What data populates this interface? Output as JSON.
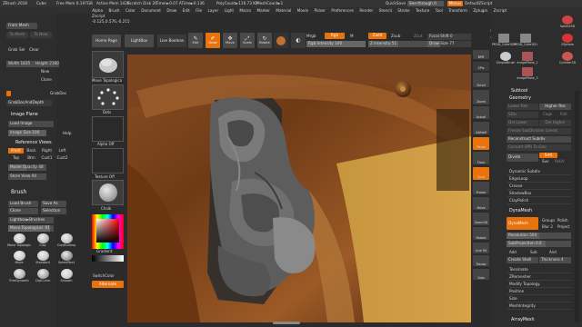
{
  "menubar": {
    "app": "ZBrush 2018",
    "doc": "Cube",
    "free_mem": "Free Mem 6.197GB",
    "active_mem": "Active Mem 1428",
    "scratch": "Scratch Disk 20",
    "timer": "Timer►0.07 ATime►0.136",
    "polycount": "PolyCount►116.73 KP",
    "meshcount": "MeshCount►1",
    "quicksave": "QuickSave",
    "seethrough": "See-through",
    "seethrough_val": "0",
    "menus_btn": "Menus",
    "default_script": "DefaultZScript",
    "items": [
      "Alpha",
      "Brush",
      "Color",
      "Document",
      "Draw",
      "Edit",
      "File",
      "Layer",
      "Light",
      "Macro",
      "Marker",
      "Material",
      "Movie",
      "Picker",
      "Preferences",
      "Render",
      "Stencil",
      "Stroke",
      "Texture",
      "Tool",
      "Transform",
      "Zplugin",
      "Zscript"
    ]
  },
  "status": {
    "zscript": "Zscript",
    "coords": "-0.125,0.576,-0.215"
  },
  "top_toolbar": {
    "home": "Home Page",
    "lightbox": "LightBox",
    "live_boolean": "Live Boolean",
    "edit": "Edit",
    "draw": "Draw",
    "move": "Move",
    "scale": "Scale",
    "rotate": "Rotate",
    "mrgb": "Mrgb",
    "rgb": "Rgb",
    "m": "M",
    "zadd": "Zadd",
    "zsub": "Zsub",
    "zcut": "Zcut",
    "rgb_intensity": "Rgb Intensity",
    "rgb_intensity_val": "100",
    "z_intensity": "Z Intensity",
    "z_intensity_val": "51",
    "focal_shift": "Focal Shift",
    "focal_shift_val": "0",
    "draw_size": "Draw Size",
    "draw_size_val": "77",
    "dynamic": "Dynamic",
    "active_points": "ActivePoints: 116,738",
    "total_points": "TotalPoints: 116,738"
  },
  "left_panel": {
    "from_mesh": "From Mesh",
    "to_mesh": "To Mesh",
    "to_new": "To New",
    "grab": "Grab",
    "sel": "Sel",
    "clear": "Clear",
    "width_label": "Width",
    "width": "1835",
    "height_label": "Height",
    "height": "2160",
    "new": "New",
    "clone": "Clone",
    "grabdoc": "GrabDoc",
    "grabdoc_and_depth": "GrabDocAndDepth",
    "image_plane": "Image Plane",
    "load_image": "Load Image",
    "image_size_label": "Image Size",
    "image_size": "100",
    "help": "Help",
    "reference_views": "Reference Views",
    "views": [
      "Front",
      "Back",
      "Right",
      "Left",
      "Top",
      "Btm",
      "Cust1",
      "Cust2"
    ],
    "model_opacity_label": "Model Opacity",
    "model_opacity": "48",
    "store_view": "Store View",
    "store_view_val": "All",
    "brush_title": "Brush",
    "load_brush": "Load Brush",
    "save_as": "Save As",
    "clone_b": "Clone",
    "selection": "Selection",
    "lightbox_brushes": "Lightbox►Brushes",
    "move_topological": "Move Topological",
    "move_topological_val": "91",
    "brushes": [
      "Move Topologic",
      "Clay",
      "ClayBuildup",
      "Move",
      "Standard",
      "SelectRect",
      "TrimDynamic",
      "ClipCurve",
      "Smooth"
    ]
  },
  "left_tools": {
    "brush_name": "Move Topologica",
    "stroke_name": "Dots",
    "alpha_name": "Alpha Off",
    "texture_name": "Texture Off",
    "material_name": "Chalk",
    "gradient": "Gradient",
    "switch_color": "SwitchColor",
    "alternate": "Alternate"
  },
  "right_shelf": {
    "bpr": "BPR",
    "spix": "SPix",
    "spix_val": "3",
    "scroll": "Scroll",
    "zoom": "Zoom",
    "actual": "Actual",
    "aahalf": "AAHalf",
    "persp": "Persp",
    "floor": "Floor",
    "local": "Local",
    "xyz": "Qxyz",
    "frame": "Frame",
    "move": "Move",
    "zoom3d": "Zoom3D",
    "rotate": "Rotate",
    "line_fill": "Line Fill",
    "polyf": "PolyF",
    "transp": "Transp",
    "ghost": "Ghost",
    "solo": "Solo",
    "xpose": "Xpose"
  },
  "right_panel": {
    "tools": [
      {
        "name": "PM3D_Cube3D1",
        "val": "2"
      },
      {
        "name": "PM3D_Cube3D1",
        "val": ""
      },
      {
        "name": "SimpleBrush",
        "val": ""
      },
      {
        "name": "ImagePlane_1",
        "val": ""
      },
      {
        "name": "ImagePlane_3",
        "val": ""
      }
    ],
    "top_tools": [
      {
        "name": "Sphere3D",
        "val": ""
      },
      {
        "name": "ZSphere",
        "val": ""
      },
      {
        "name": "Cylinder3D",
        "val": ""
      }
    ],
    "subtool": "Subtool",
    "geometry": "Geometry",
    "lower_res": "Lower Res",
    "higher_res": "Higher Res",
    "sdiv": "SDiv",
    "cage": "Cage",
    "rstr": "Rstr",
    "del_lower": "Del Lower",
    "del_higher": "Del Higher",
    "freeze_subdiv": "Freeze SubDivision Levels",
    "reconstruct_subdiv": "Reconstruct Subdiv",
    "convert_bpr": "Convert BPR To Geo",
    "divide": "Divide",
    "smt": "Smt",
    "suv": "Suv",
    "reuv": "ReUV",
    "dynamic_subdiv": "Dynamic Subdiv",
    "edgeloop": "EdgeLoop",
    "crease": "Crease",
    "shadowbox": "ShadowBox",
    "claypolish": "ClayPolish",
    "dynamesh_header": "DynaMesh",
    "dynamesh": "DynaMesh",
    "groups": "Groups",
    "polish": "Polish",
    "blur": "Blur",
    "blur_val": "2",
    "project": "Project",
    "resolution_label": "Resolution",
    "resolution": "504",
    "subprojection_label": "SubProjection",
    "subprojection": "0.6",
    "add": "Add",
    "sub": "Sub",
    "and": "And",
    "create_shell": "Create Shell",
    "thickness_label": "Thickness",
    "thickness": "4",
    "tessimate": "Tessimate",
    "zremesher": "ZRemesher",
    "modify_topology": "Modify Topology",
    "position": "Position",
    "size": "Size",
    "meshintegrity": "MeshIntegrity",
    "arraymesh": "ArrayMesh"
  },
  "colors": {
    "accent": "#e8720c",
    "panel": "#2b2b2b",
    "button": "#4a4a4a"
  }
}
